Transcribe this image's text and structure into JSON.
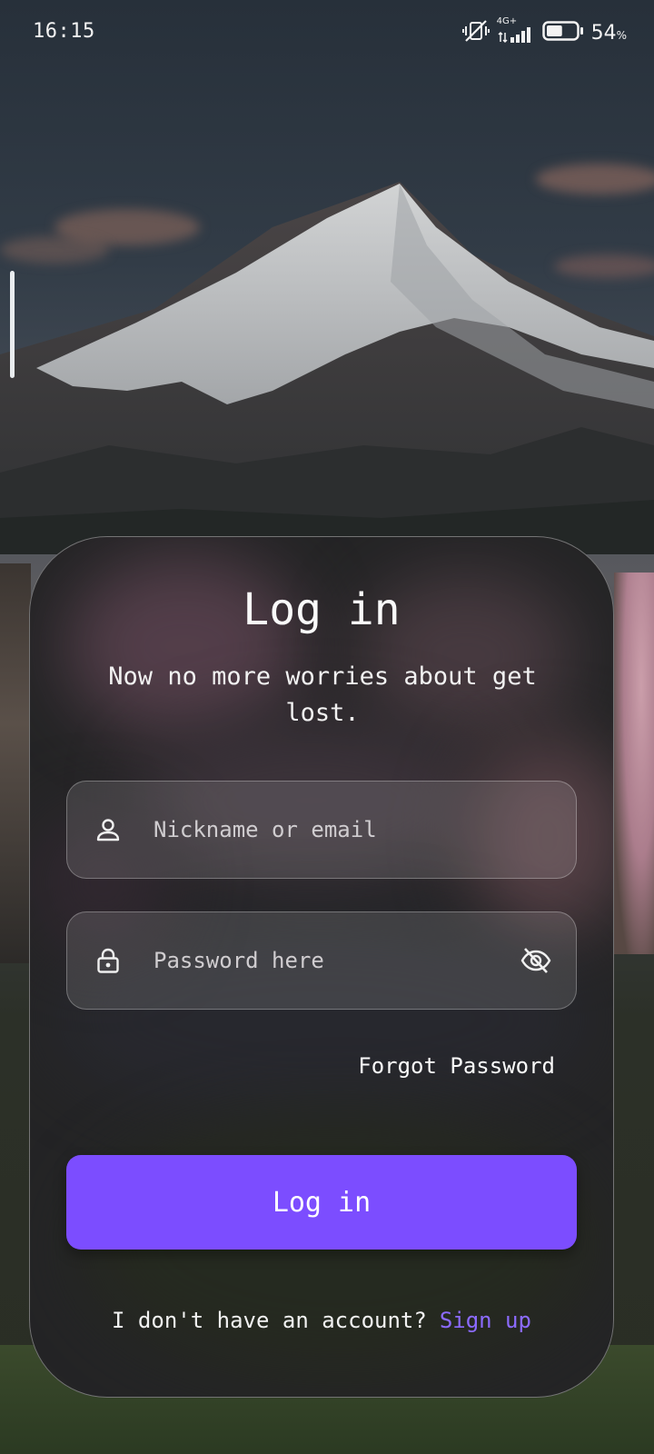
{
  "status_bar": {
    "time": "16:15",
    "network": "4G+",
    "battery_percent": "54",
    "battery_unit": "%",
    "battery_level": 0.54,
    "icons": [
      "vibrate-off-icon",
      "signal-icon",
      "battery-icon"
    ]
  },
  "login": {
    "title": "Log in",
    "subtitle": "Now no more worries about get lost.",
    "username_placeholder": "Nickname or email",
    "password_placeholder": "Password here",
    "forgot_password": "Forgot Password",
    "submit_label": "Log in",
    "no_account_text": "I don't have an account?",
    "signup_link": "Sign up"
  },
  "colors": {
    "accent": "#7c4dff",
    "link": "#8c6bff"
  }
}
